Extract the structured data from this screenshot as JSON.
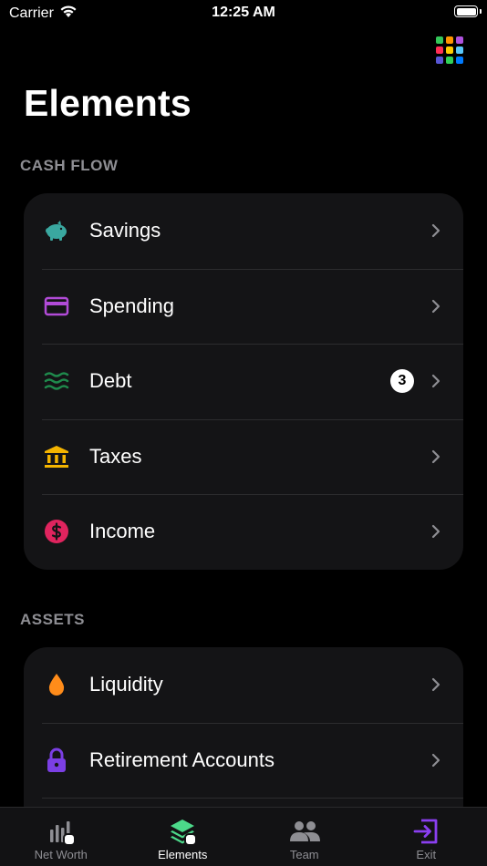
{
  "status_bar": {
    "carrier": "Carrier",
    "time": "12:25 AM"
  },
  "header": {
    "title": "Elements",
    "grid_colors": [
      "#34c759",
      "#ff9500",
      "#af52de",
      "#ff2d55",
      "#ffcc00",
      "#5ac8fa",
      "#5856d6",
      "#30d158",
      "#007aff"
    ]
  },
  "sections": [
    {
      "header": "CASH FLOW",
      "items": [
        {
          "label": "Savings",
          "icon": "piggy-bank-icon",
          "color": "#3aa8a0",
          "badge": ""
        },
        {
          "label": "Spending",
          "icon": "credit-card-icon",
          "color": "#b24bd8",
          "badge": ""
        },
        {
          "label": "Debt",
          "icon": "waves-icon",
          "color": "#1f8a4c",
          "badge": "3"
        },
        {
          "label": "Taxes",
          "icon": "bank-icon",
          "color": "#f4b400",
          "badge": ""
        },
        {
          "label": "Income",
          "icon": "dollar-icon",
          "color": "#e0245e",
          "badge": ""
        }
      ]
    },
    {
      "header": "ASSETS",
      "items": [
        {
          "label": "Liquidity",
          "icon": "drop-icon",
          "color": "#ff8c1a",
          "badge": ""
        },
        {
          "label": "Retirement Accounts",
          "icon": "lock-icon",
          "color": "#7b3fe4",
          "badge": ""
        }
      ]
    }
  ],
  "tab_bar": {
    "tabs": [
      {
        "label": "Net Worth",
        "icon": "bar-chart-icon",
        "active": false
      },
      {
        "label": "Elements",
        "icon": "layers-icon",
        "active": true
      },
      {
        "label": "Team",
        "icon": "people-icon",
        "active": false
      },
      {
        "label": "Exit",
        "icon": "exit-icon",
        "active": false
      }
    ]
  }
}
